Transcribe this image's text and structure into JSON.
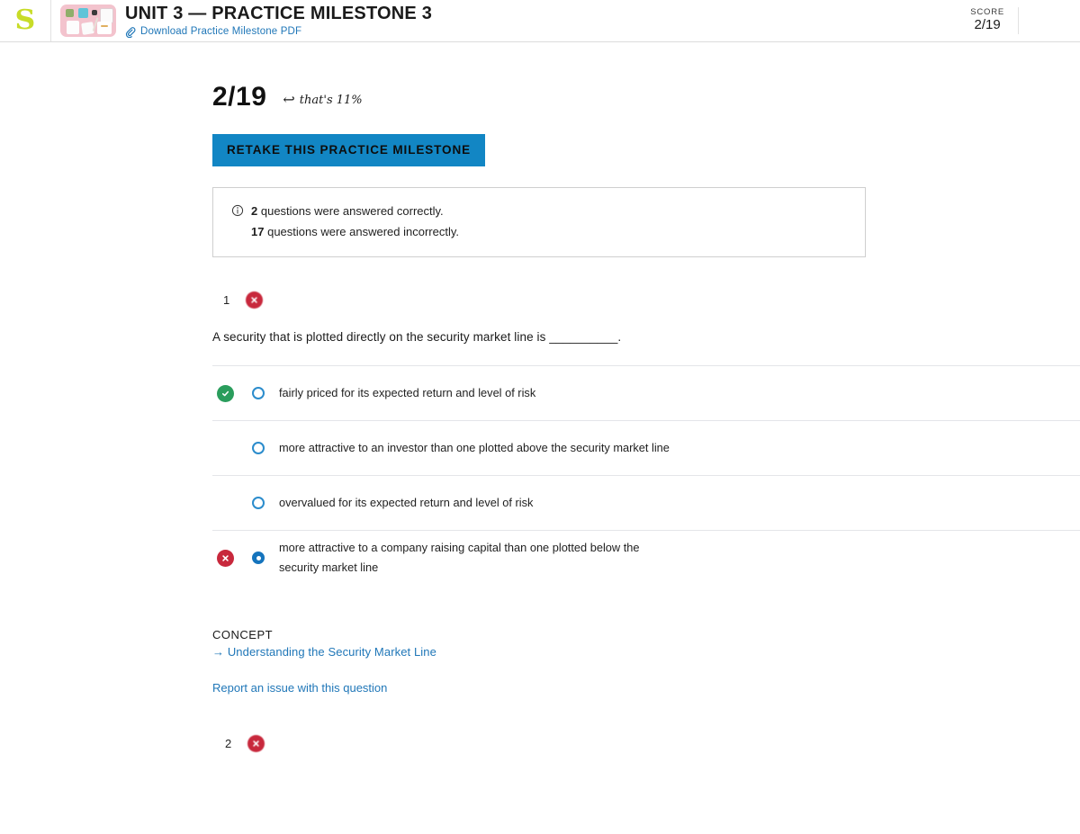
{
  "header": {
    "logo_letter": "S",
    "unit_title": "UNIT 3 — PRACTICE MILESTONE 3",
    "pdf_link": "Download Practice Milestone PDF",
    "score_label": "SCORE",
    "score_value": "2/19"
  },
  "summary": {
    "score_big": "2/19",
    "annotation": "that's 11%",
    "retake_button": "RETAKE THIS PRACTICE MILESTONE",
    "correct_line_num": "2",
    "correct_line_text": "questions were answered correctly.",
    "incorrect_line_num": "17",
    "incorrect_line_text": "questions were answered incorrectly."
  },
  "questions": [
    {
      "number": "1",
      "result": "incorrect",
      "text": "A security that is plotted directly on the security market line is __________.",
      "options": [
        {
          "label": "fairly priced for its expected return and level of risk",
          "selected": false,
          "mark": "correct"
        },
        {
          "label": "more attractive to an investor than one plotted above the security market line",
          "selected": false,
          "mark": "none"
        },
        {
          "label": "overvalued for its expected return and level of risk",
          "selected": false,
          "mark": "none"
        },
        {
          "label": "more attractive to a company raising capital than one plotted below the security market line",
          "selected": true,
          "mark": "incorrect"
        }
      ],
      "concept_label": "CONCEPT",
      "concept_link": "Understanding the Security Market Line",
      "report_link": "Report an issue with this question"
    },
    {
      "number": "2",
      "result": "incorrect"
    }
  ],
  "colors": {
    "accent_blue": "#1286c4",
    "link_blue": "#2077b8",
    "correct_green": "#2a9d5c",
    "incorrect_red": "#c8283c",
    "logo_green": "#c8dc28"
  }
}
